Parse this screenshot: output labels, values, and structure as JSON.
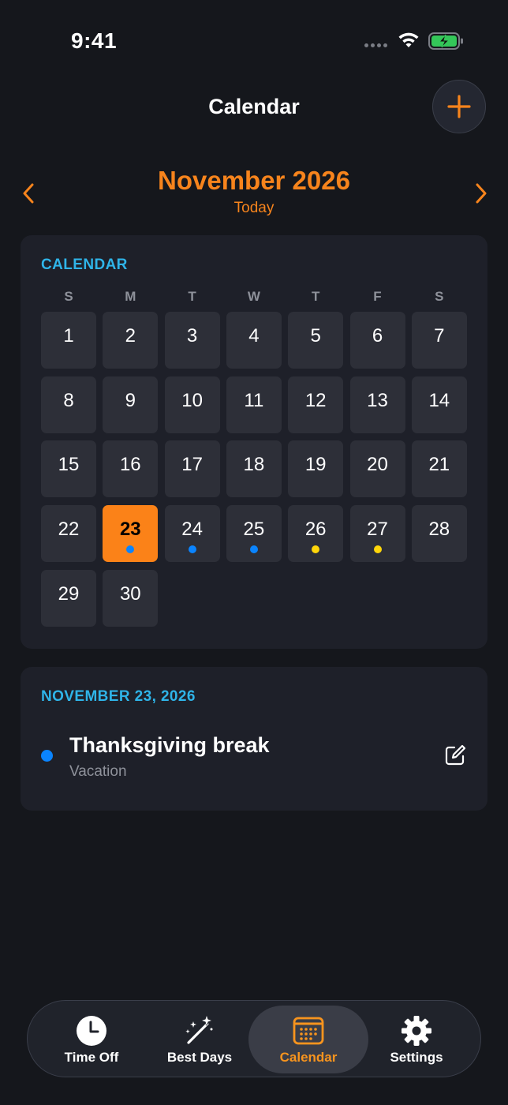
{
  "status_bar": {
    "time": "9:41"
  },
  "header": {
    "title": "Calendar",
    "add_button_icon": "plus-icon"
  },
  "month_nav": {
    "title": "November 2026",
    "today_label": "Today",
    "prev_icon": "chevron-left-icon",
    "next_icon": "chevron-right-icon"
  },
  "calendar": {
    "section_label": "CALENDAR",
    "weekdays": [
      "S",
      "M",
      "T",
      "W",
      "T",
      "F",
      "S"
    ],
    "days": [
      {
        "day": "1",
        "dot": null
      },
      {
        "day": "2",
        "dot": null
      },
      {
        "day": "3",
        "dot": null
      },
      {
        "day": "4",
        "dot": null
      },
      {
        "day": "5",
        "dot": null
      },
      {
        "day": "6",
        "dot": null
      },
      {
        "day": "7",
        "dot": null
      },
      {
        "day": "8",
        "dot": null
      },
      {
        "day": "9",
        "dot": null
      },
      {
        "day": "10",
        "dot": null
      },
      {
        "day": "11",
        "dot": null
      },
      {
        "day": "12",
        "dot": null
      },
      {
        "day": "13",
        "dot": null
      },
      {
        "day": "14",
        "dot": null
      },
      {
        "day": "15",
        "dot": null
      },
      {
        "day": "16",
        "dot": null
      },
      {
        "day": "17",
        "dot": null
      },
      {
        "day": "18",
        "dot": null
      },
      {
        "day": "19",
        "dot": null
      },
      {
        "day": "20",
        "dot": null
      },
      {
        "day": "21",
        "dot": null
      },
      {
        "day": "22",
        "dot": null
      },
      {
        "day": "23",
        "dot": "#0a84ff",
        "selected": true
      },
      {
        "day": "24",
        "dot": "#0a84ff"
      },
      {
        "day": "25",
        "dot": "#0a84ff"
      },
      {
        "day": "26",
        "dot": "#ffd60a"
      },
      {
        "day": "27",
        "dot": "#ffd60a"
      },
      {
        "day": "28",
        "dot": null
      },
      {
        "day": "29",
        "dot": null
      },
      {
        "day": "30",
        "dot": null
      }
    ]
  },
  "selected_day": {
    "date_label": "NOVEMBER 23, 2026",
    "events": [
      {
        "title": "Thanksgiving break",
        "type": "Vacation",
        "color": "#0a84ff",
        "edit_icon": "edit-icon"
      }
    ]
  },
  "tab_bar": {
    "tabs": [
      {
        "label": "Time Off",
        "icon": "clock-icon",
        "active": false
      },
      {
        "label": "Best Days",
        "icon": "magic-wand-icon",
        "active": false
      },
      {
        "label": "Calendar",
        "icon": "calendar-icon",
        "active": true
      },
      {
        "label": "Settings",
        "icon": "gear-icon",
        "active": false
      }
    ]
  },
  "colors": {
    "accent": "#f7841c",
    "section_label": "#2fb4e8",
    "vacation": "#0a84ff",
    "holiday": "#ffd60a",
    "background": "#15171c"
  }
}
